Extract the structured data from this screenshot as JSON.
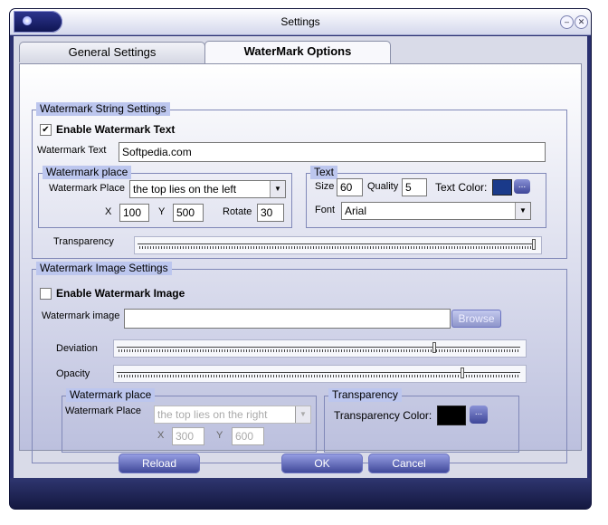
{
  "window": {
    "title": "Settings"
  },
  "tabs": {
    "general": "General Settings",
    "watermark": "WaterMark Options"
  },
  "string_settings": {
    "title": "Watermark String Settings",
    "enable_label": "Enable Watermark Text",
    "enable_checked": "✔",
    "text_label": "Watermark Text",
    "text_value": "Softpedia.com",
    "place": {
      "title": "Watermark place",
      "place_label": "Watermark Place",
      "place_value": "the top lies on the left",
      "x_label": "X",
      "x_value": "100",
      "y_label": "Y",
      "y_value": "500",
      "rotate_label": "Rotate",
      "rotate_value": "30"
    },
    "text_group": {
      "title": "Text",
      "size_label": "Size",
      "size_value": "60",
      "quality_label": "Quality",
      "quality_value": "5",
      "color_label": "Text Color:",
      "color": "#1a3a8a",
      "font_label": "Font",
      "font_value": "Arial",
      "more_label": "..."
    },
    "transparency_label": "Transparency",
    "transparency_level": 1.0
  },
  "image_settings": {
    "title": "Watermark Image Settings",
    "enable_label": "Enable Watermark Image",
    "image_label": "Watermark image",
    "image_value": "",
    "browse_label": "Browse",
    "deviation_label": "Deviation",
    "deviation_level": 0.79,
    "opacity_label": "Opacity",
    "opacity_level": 0.86,
    "place": {
      "title": "Watermark place",
      "place_label": "Watermark Place",
      "place_value": "the top lies on the right",
      "x_label": "X",
      "x_value": "300",
      "y_label": "Y",
      "y_value": "600"
    },
    "transparency": {
      "title": "Transparency",
      "color_label": "Transparency Color:",
      "color": "#000000",
      "more_label": "..."
    }
  },
  "buttons": {
    "reload": "Reload",
    "ok": "OK",
    "cancel": "Cancel"
  },
  "icons": {
    "dropdown": "▼"
  }
}
